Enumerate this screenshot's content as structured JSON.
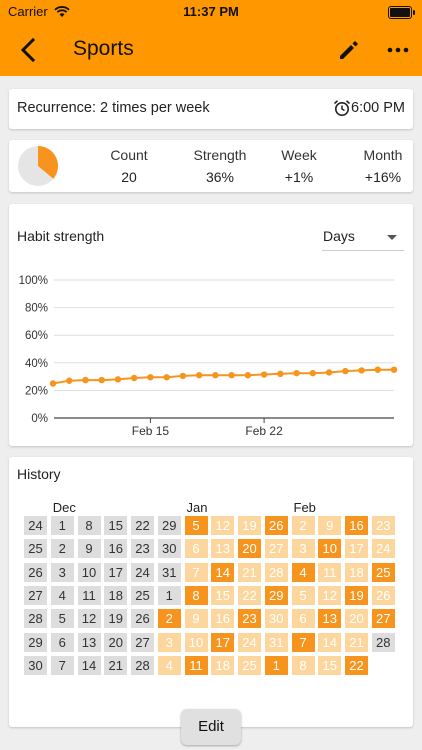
{
  "status_bar": {
    "carrier": "Carrier",
    "time": "11:37 PM"
  },
  "header": {
    "title": "Sports",
    "back_icon": "arrow-back-icon",
    "edit_icon": "pencil-icon",
    "more_icon": "more-horiz-icon"
  },
  "recurrence": {
    "text": "Recurrence: 2 times per week",
    "reminder_icon": "alarm-clock-icon",
    "reminder_time": "6:00 PM"
  },
  "overview": {
    "score_fraction": 0.36,
    "stats": [
      {
        "label": "Count",
        "value": "20"
      },
      {
        "label": "Strength",
        "value": "36%"
      },
      {
        "label": "Week",
        "value": "+1%"
      },
      {
        "label": "Month",
        "value": "+16%"
      }
    ]
  },
  "strength_card": {
    "title": "Habit strength",
    "dropdown": "Days"
  },
  "chart_data": {
    "type": "line",
    "title": "",
    "y_ticks": [
      "100%",
      "80%",
      "60%",
      "40%",
      "20%",
      "0%"
    ],
    "ylim": [
      0,
      100
    ],
    "x_ticks": [
      {
        "label": "Feb 15",
        "index": 6
      },
      {
        "label": "Feb 22",
        "index": 13
      }
    ],
    "x_dates": [
      "Feb 9",
      "Feb 10",
      "Feb 11",
      "Feb 12",
      "Feb 13",
      "Feb 14",
      "Feb 15",
      "Feb 16",
      "Feb 17",
      "Feb 18",
      "Feb 19",
      "Feb 20",
      "Feb 21",
      "Feb 22",
      "Feb 23",
      "Feb 24",
      "Feb 25",
      "Feb 26",
      "Feb 27",
      "Feb 28",
      "Mar 1",
      "Mar 2"
    ],
    "values": [
      25,
      27,
      27.5,
      27.5,
      28,
      29,
      29.5,
      29.5,
      30.5,
      31,
      31,
      31,
      31,
      31.5,
      32,
      32.5,
      32.5,
      33,
      34,
      34.5,
      35,
      35
    ],
    "grid": true,
    "color": "#f7941d"
  },
  "history": {
    "title": "History",
    "months": [
      {
        "label": "Dec",
        "col": 1
      },
      {
        "label": "Jan",
        "col": 6
      },
      {
        "label": "Feb",
        "col": 10
      }
    ],
    "columns": [
      {
        "days": [
          "24",
          "25",
          "26",
          "27",
          "28",
          "29",
          "30"
        ],
        "levels": [
          0,
          0,
          0,
          0,
          0,
          0,
          0
        ]
      },
      {
        "days": [
          "1",
          "2",
          "3",
          "4",
          "5",
          "6",
          "7"
        ],
        "levels": [
          0,
          0,
          0,
          0,
          0,
          0,
          0
        ]
      },
      {
        "days": [
          "8",
          "9",
          "10",
          "11",
          "12",
          "13",
          "14"
        ],
        "levels": [
          0,
          0,
          0,
          0,
          0,
          0,
          0
        ]
      },
      {
        "days": [
          "15",
          "16",
          "17",
          "18",
          "19",
          "20",
          "21"
        ],
        "levels": [
          0,
          0,
          0,
          0,
          0,
          0,
          0
        ]
      },
      {
        "days": [
          "22",
          "23",
          "24",
          "25",
          "26",
          "27",
          "28"
        ],
        "levels": [
          0,
          0,
          0,
          0,
          0,
          0,
          0
        ]
      },
      {
        "days": [
          "29",
          "30",
          "31",
          "1",
          "2",
          "3",
          "4"
        ],
        "levels": [
          0,
          0,
          0,
          0,
          3,
          1,
          1
        ]
      },
      {
        "days": [
          "5",
          "6",
          "7",
          "8",
          "9",
          "10",
          "11"
        ],
        "levels": [
          3,
          1,
          1,
          3,
          1,
          1,
          3
        ]
      },
      {
        "days": [
          "12",
          "13",
          "14",
          "15",
          "16",
          "17",
          "18"
        ],
        "levels": [
          1,
          1,
          3,
          1,
          1,
          3,
          1
        ]
      },
      {
        "days": [
          "19",
          "20",
          "21",
          "22",
          "23",
          "24",
          "25"
        ],
        "levels": [
          1,
          3,
          1,
          1,
          3,
          1,
          1
        ]
      },
      {
        "days": [
          "26",
          "27",
          "28",
          "29",
          "30",
          "31",
          "1"
        ],
        "levels": [
          3,
          1,
          1,
          3,
          1,
          1,
          3
        ]
      },
      {
        "days": [
          "2",
          "3",
          "4",
          "5",
          "6",
          "7",
          "8"
        ],
        "levels": [
          1,
          1,
          3,
          1,
          1,
          3,
          1
        ]
      },
      {
        "days": [
          "9",
          "10",
          "11",
          "12",
          "13",
          "14",
          "15"
        ],
        "levels": [
          1,
          3,
          1,
          1,
          3,
          1,
          1
        ]
      },
      {
        "days": [
          "16",
          "17",
          "18",
          "19",
          "20",
          "21",
          "22"
        ],
        "levels": [
          3,
          1,
          1,
          3,
          1,
          1,
          3
        ]
      },
      {
        "days": [
          "23",
          "24",
          "25",
          "26",
          "27",
          "28",
          ""
        ],
        "levels": [
          1,
          1,
          3,
          1,
          3,
          0,
          -1
        ]
      }
    ],
    "level_colors": {
      "0": "#dddddd",
      "1": "#fcd69d",
      "3": "#f7941d"
    }
  },
  "edit_button": "Edit"
}
